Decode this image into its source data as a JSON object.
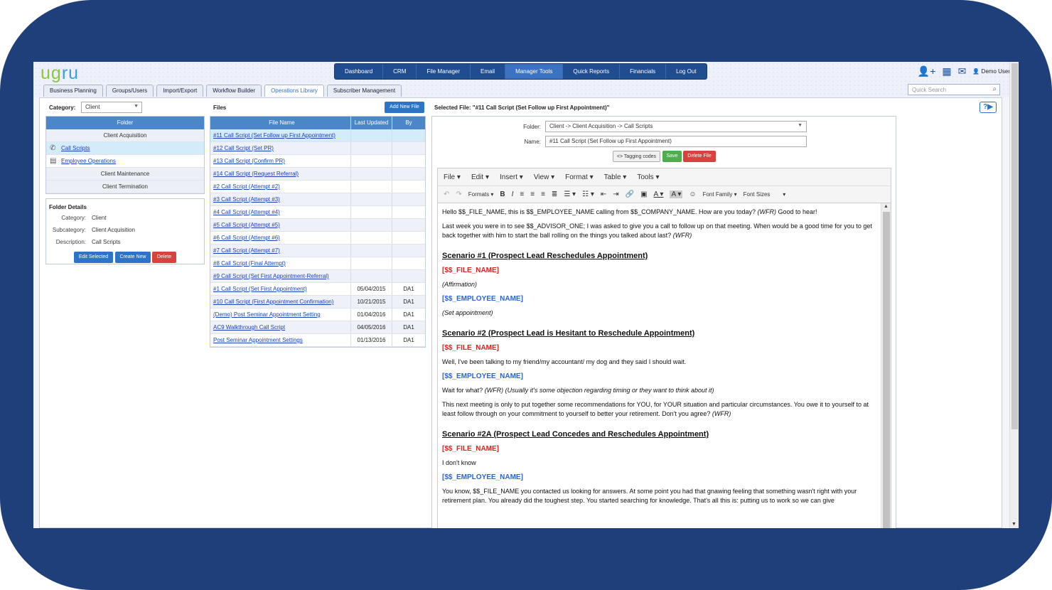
{
  "logo": {
    "text1": "ug",
    "text2": "ru"
  },
  "nav": [
    "Dashboard",
    "CRM",
    "File Manager",
    "Email",
    "Manager Tools",
    "Quick Reports",
    "Financials",
    "Log Out"
  ],
  "user": "Demo User",
  "tabs": [
    "Business Planning",
    "Groups/Users",
    "Import/Export",
    "Workflow Builder",
    "Operations Library",
    "Subscriber Management"
  ],
  "search": {
    "placeholder": "Quick Search"
  },
  "category": {
    "label": "Category:",
    "value": "Client"
  },
  "folders": {
    "header": "Folder",
    "items": [
      "Client Acquisition",
      "Call Scripts",
      "Employee Operations",
      "Client Maintenance",
      "Client Termination"
    ]
  },
  "details": {
    "title": "Folder Details",
    "category_k": "Category:",
    "category_v": "Client",
    "subcategory_k": "Subcategory:",
    "subcategory_v": "Client Acquisition",
    "description_k": "Description:",
    "description_v": "Call Scripts",
    "edit": "Edit Selected",
    "create": "Create New",
    "delete": "Delete"
  },
  "files": {
    "label": "Files",
    "add": "Add New File",
    "headers": [
      "File Name",
      "Last Updated",
      "By"
    ],
    "rows": [
      [
        "#11 Call Script (Set Follow up First Appointment)",
        "",
        ""
      ],
      [
        "#12 Call Script (Set PR)",
        "",
        ""
      ],
      [
        "#13 Call Script (Confirm PR)",
        "",
        ""
      ],
      [
        "#14 Call Script (Request Referral)",
        "",
        ""
      ],
      [
        "#2 Call Script (Attempt #2)",
        "",
        ""
      ],
      [
        "#3 Call Script (Attempt #3)",
        "",
        ""
      ],
      [
        "#4 Call Script (Attempt #4)",
        "",
        ""
      ],
      [
        "#5 Call Script (Attempt #5)",
        "",
        ""
      ],
      [
        "#6 Call Script (Attempt #6)",
        "",
        ""
      ],
      [
        "#7 Call Script (Attempt #7)",
        "",
        ""
      ],
      [
        "#8 Call Script (Final Attempt)",
        "",
        ""
      ],
      [
        "#9 Call Script (Set First Appointment-Referral)",
        "",
        ""
      ],
      [
        "#1 Call Script (Set First Appointment)",
        "05/04/2015",
        "DA1"
      ],
      [
        "#10 Call Script (First Appointment Confirmation)",
        "10/21/2015",
        "DA1"
      ],
      [
        "(Demo) Post Seminar Appointment Setting",
        "01/04/2016",
        "DA1"
      ],
      [
        "AC9 Walkthrough Call Script",
        "04/05/2016",
        "DA1"
      ],
      [
        "Post Seminar Appointment Settings",
        "01/13/2016",
        "DA1"
      ]
    ]
  },
  "selected": "Selected File: \"#11 Call Script (Set Follow up First Appointment)\"",
  "editor": {
    "folder_label": "Folder:",
    "folder_value": "Client -> Client Acquisition -> Call Scripts",
    "name_label": "Name:",
    "name_value": "#11 Call Script (Set Follow up First Appointment)",
    "tagging": "<> Tagging codes",
    "save": "Save",
    "delete": "Delete File",
    "menu": [
      "File",
      "Edit",
      "Insert",
      "View",
      "Format",
      "Table",
      "Tools"
    ],
    "formats": "Formats",
    "font_family": "Font Family",
    "font_sizes": "Font Sizes"
  },
  "doc": {
    "p1a": "Hello $$_FILE_NAME, this is $$_EMPLOYEE_NAME calling from $$_COMPANY_NAME. How are you today? ",
    "p1b": "(WFR)",
    "p1c": " Good to hear!",
    "p2a": "Last week you were in to see $$_ADVISOR_ONE; I was asked to give you a call to follow up on that meeting. When would be a good time for you to get back together with him to start the ball rolling on the things you talked about last? ",
    "p2b": "(WFR)",
    "h1": "Scenario #1 (Prospect Lead Reschedules Appointment)",
    "tag_file": "[$$_FILE_NAME]",
    "tag_emp": "[$$_EMPLOYEE_NAME]",
    "aff": "(Affirmation)",
    "setapp": "(Set appointment)",
    "h2": "Scenario #2 (Prospect Lead is Hesitant to Reschedule Appointment)",
    "p3": "Well, I've been talking to my friend/my accountant/ my dog and they said I should wait.",
    "p4a": "Wait for what? ",
    "p4b": "(WFR) (Usually it's some objection regarding timing or they want to think about it)",
    "p5a": "This next meeting is only to put together some recommendations for YOU, for YOUR situation and particular circumstances. You owe it to yourself to at least follow through on your commitment to yourself to better your retirement. Don't you agree? ",
    "p5b": "(WFR)",
    "h3": "Scenario #2A (Prospect Lead Concedes and Reschedules Appointment)",
    "p6": "I don't know",
    "p7": "You know, $$_FILE_NAME you contacted us looking for answers. At some point you had that gnawing feeling that something wasn't right with your retirement plan. You already did the toughest step. You started searching for knowledge. That's all this is: putting us to work so we can give"
  },
  "help": "?▶"
}
